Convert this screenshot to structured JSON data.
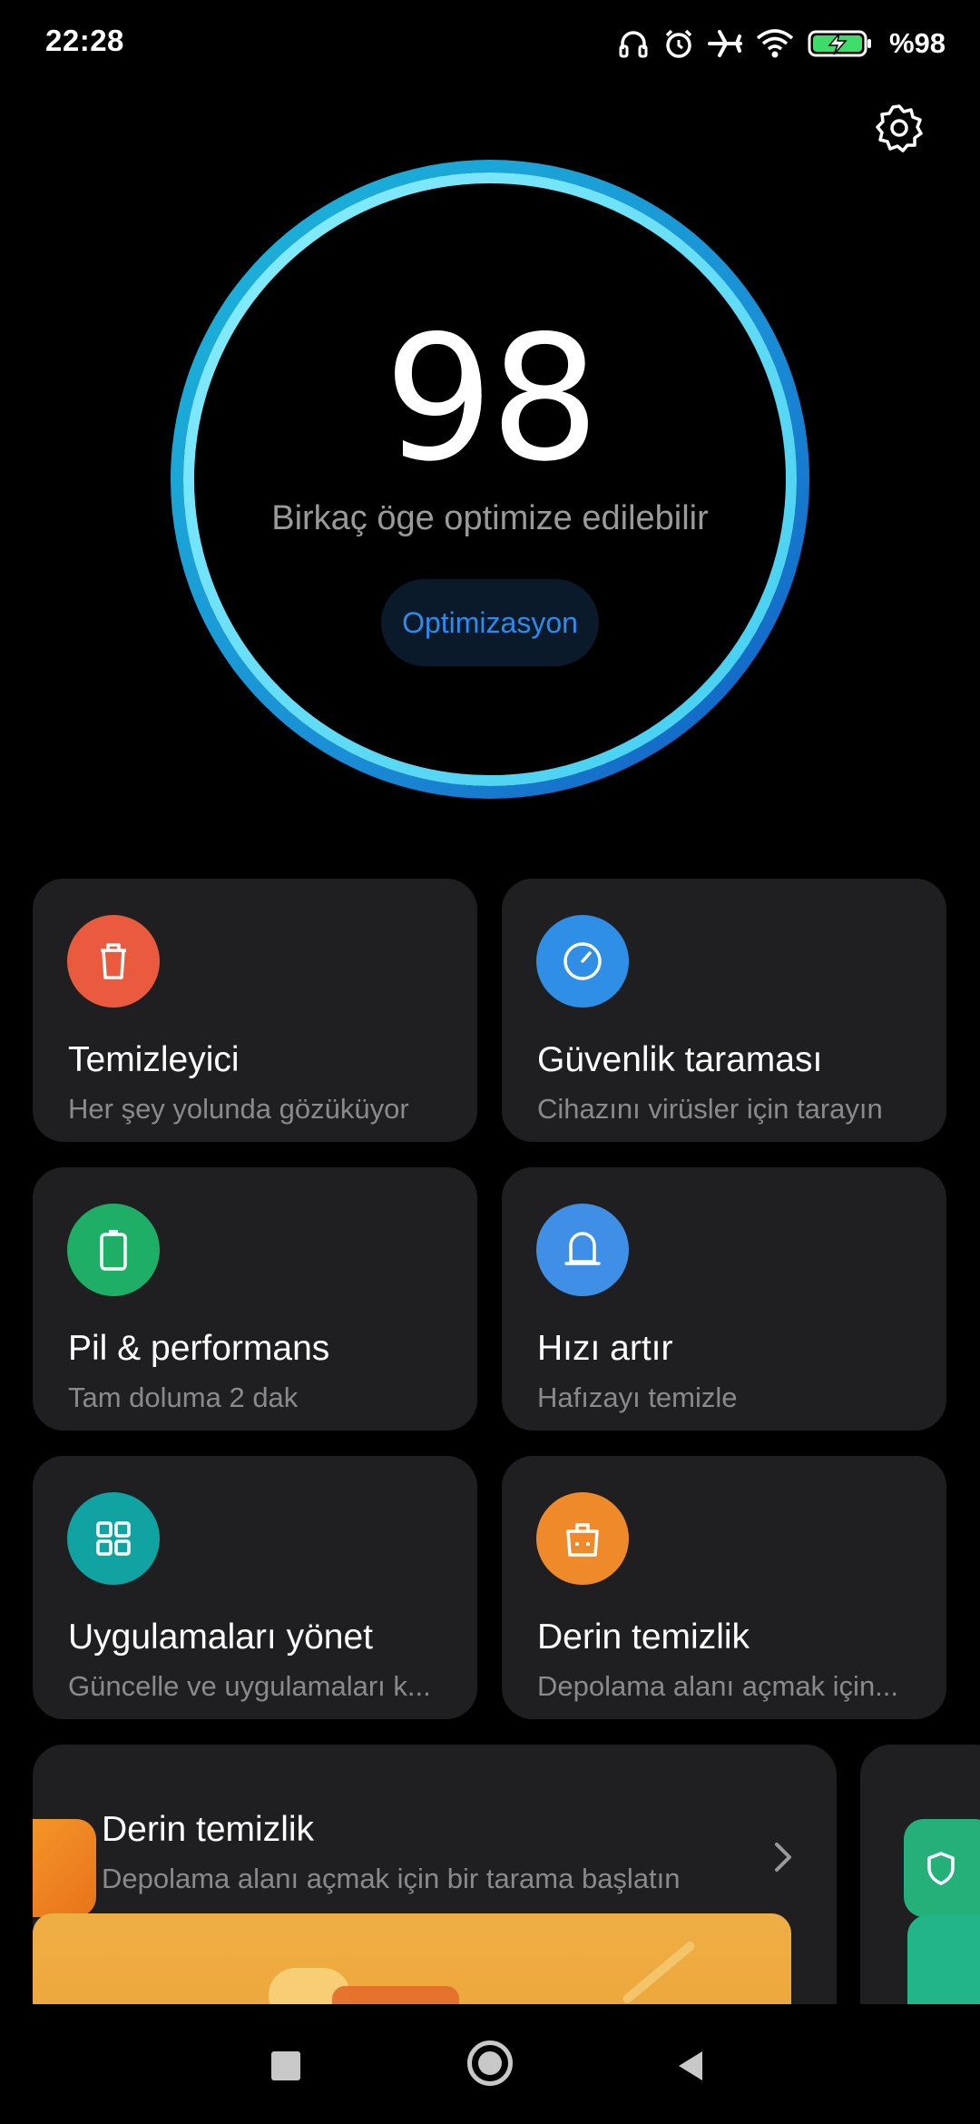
{
  "status_bar": {
    "time": "22:28",
    "battery_text": "%98",
    "icons": [
      "headphones-icon",
      "alarm-icon",
      "airplane-icon",
      "wifi-icon",
      "battery-charging-icon"
    ]
  },
  "header": {
    "settings_icon": "gear-icon"
  },
  "score": {
    "value": "98",
    "subtitle": "Birkaç öge optimize edilebilir",
    "button_label": "Optimizasyon",
    "ring_colors": [
      "#64e0f6",
      "#1aa6d6",
      "#1565c8"
    ]
  },
  "cards": [
    {
      "title": "Temizleyici",
      "subtitle": "Her şey yolunda gözüküyor",
      "icon": "trash-icon",
      "color": "#ea5a3f"
    },
    {
      "title": "Güvenlik taraması",
      "subtitle": "Cihazını virüsler için tarayın",
      "icon": "gauge-icon",
      "color": "#2f8ee6"
    },
    {
      "title": "Pil & performans",
      "subtitle": "Tam doluma 2 dak",
      "icon": "battery-icon",
      "color": "#1fae66"
    },
    {
      "title": "Hızı artır",
      "subtitle": "Hafızayı temizle",
      "icon": "bell-icon",
      "color": "#3f8fe6"
    },
    {
      "title": "Uygulamaları yönet",
      "subtitle": "Güncelle ve uygulamaları k...",
      "icon": "apps-grid-icon",
      "color": "#11a2a2"
    },
    {
      "title": "Derin temizlik",
      "subtitle": "Depolama alanı açmak için...",
      "icon": "briefcase-icon",
      "color": "#ee8a2a"
    }
  ],
  "feature": {
    "title": "Derin temizlik",
    "subtitle": "Depolama alanı açmak için bir tarama başlatın",
    "chevron_icon": "chevron-right-icon"
  },
  "nav": {
    "icons": [
      "recent-apps-icon",
      "home-icon",
      "back-icon"
    ]
  }
}
